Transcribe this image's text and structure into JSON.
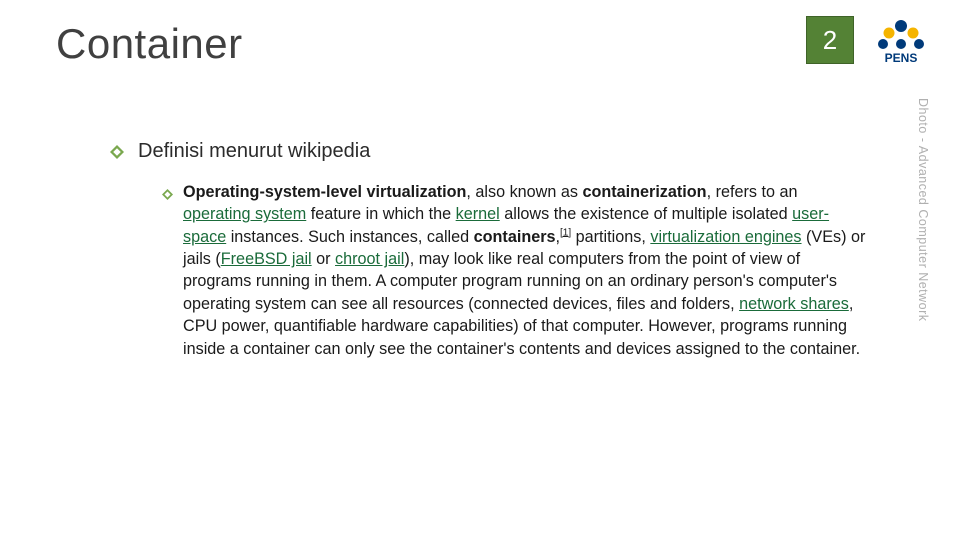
{
  "title": "Container",
  "page_number": "2",
  "side_label": "Dhoto - Advanced Computer Network",
  "logo_text": "PENS",
  "bullets": {
    "lvl1": {
      "label": "Definisi menurut wikipedia"
    },
    "lvl2": {
      "segments": {
        "s0": "Operating-system-level virtualization",
        "s1": ", also known as ",
        "s2": "containerization",
        "s3": ", refers to an ",
        "s4": "operating system",
        "s5": " feature in which the ",
        "s6": "kernel",
        "s7": " allows the existence of multiple isolated ",
        "s8": "user-space",
        "s9": " instances. Such instances, called ",
        "s10": "containers",
        "s11": ",",
        "s12": "[1]",
        "s13": " partitions, ",
        "s14": "virtualization engines",
        "s15": " (VEs) or jails (",
        "s16": "FreeBSD jail",
        "s17": " or ",
        "s18": "chroot jail",
        "s19": "), may look like real computers from the point of view of programs running in them. A computer program running on an ordinary person's computer's operating system can see all resources (connected devices, files and folders, ",
        "s20": "network shares",
        "s21": ", CPU power, quantifiable hardware capabilities) of that computer. However, programs running inside a container can only see the container's contents and devices assigned to the container."
      }
    }
  }
}
